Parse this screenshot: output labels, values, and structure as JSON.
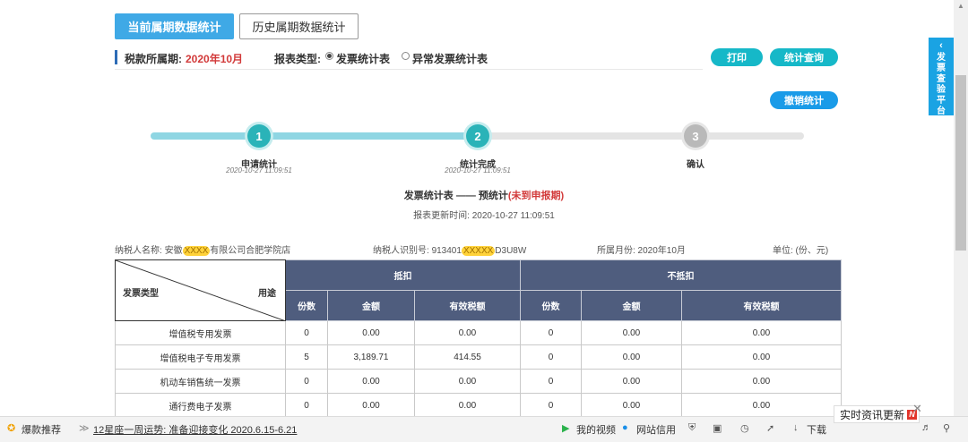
{
  "tabs": {
    "current": "当前属期数据统计",
    "history": "历史属期数据统计"
  },
  "period": {
    "label": "税款所属期:",
    "value": "2020年10月"
  },
  "report_type": {
    "label": "报表类型:",
    "options": [
      "发票统计表",
      "异常发票统计表"
    ],
    "selected": "发票统计表"
  },
  "buttons": {
    "print": "打印",
    "query": "统计查询",
    "cancel": "撤销统计"
  },
  "steps": [
    {
      "num": "1",
      "label": "申请统计",
      "time": "2020-10-27 11:09:51",
      "state": "done"
    },
    {
      "num": "2",
      "label": "统计完成",
      "time": "2020-10-27 11:09:51",
      "state": "done"
    },
    {
      "num": "3",
      "label": "确认",
      "time": "",
      "state": "todo"
    }
  ],
  "report": {
    "title_main": "发票统计表 —— 预统计",
    "title_status": "(未到申报期)",
    "update_time": "报表更新时间: 2020-10-27 11:09:51"
  },
  "taxpayer": {
    "name_label": "纳税人名称:",
    "name_prefix": "安徽",
    "name_hidden": "XXXX",
    "name_suffix": "有限公司合肥学院店",
    "id_label": "纳税人识别号:",
    "id_prefix": "913401",
    "id_hidden": "XXXXX",
    "id_suffix": "D3U8W",
    "month_label": "所属月份: 2020年10月",
    "unit": "单位: (份、元)"
  },
  "table": {
    "corner_left": "发票类型",
    "corner_right": "用途",
    "group_deduct": "抵扣",
    "group_nondeduct": "不抵扣",
    "sub_headers": [
      "份数",
      "金额",
      "有效税额",
      "份数",
      "金额",
      "有效税额"
    ],
    "rows": [
      [
        "增值税专用发票",
        "0",
        "0.00",
        "0.00",
        "0",
        "0.00",
        "0.00"
      ],
      [
        "增值税电子专用发票",
        "5",
        "3,189.71",
        "414.55",
        "0",
        "0.00",
        "0.00"
      ],
      [
        "机动车销售统一发票",
        "0",
        "0.00",
        "0.00",
        "0",
        "0.00",
        "0.00"
      ],
      [
        "通行费电子发票",
        "0",
        "0.00",
        "0.00",
        "0",
        "0.00",
        "0.00"
      ]
    ]
  },
  "side_panel": {
    "label": "发票查验平台"
  },
  "browser_bar": {
    "recommend": "爆款推荐",
    "headline": "12星座一周运势: 准备迎接变化 2020.6.15-6.21",
    "my_video": "我的视频",
    "site_credit": "网站信用",
    "download": "下载",
    "news": "实时资讯更新",
    "news_badge": "N"
  }
}
